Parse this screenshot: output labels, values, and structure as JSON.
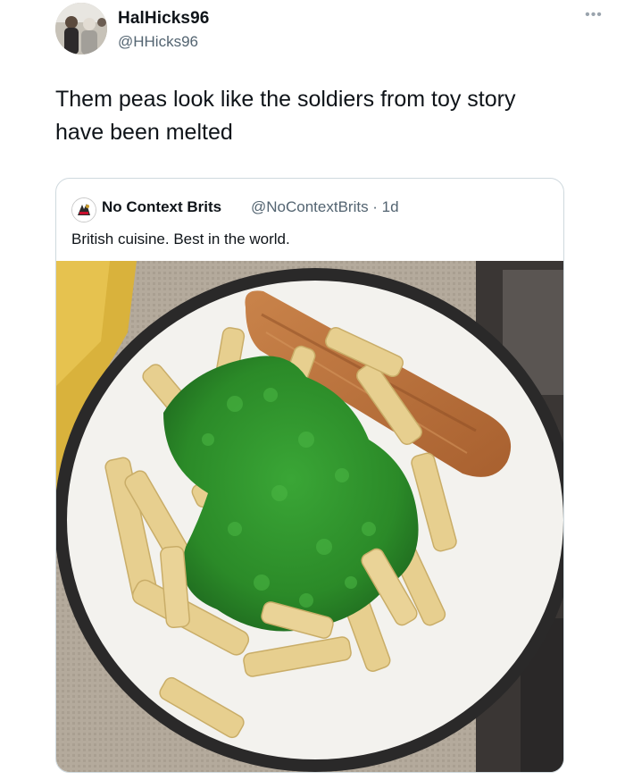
{
  "tweet": {
    "display_name": "HalHicks96",
    "handle": "@HHicks96",
    "more_icon": "ellipsis-icon",
    "text": "Them peas look like the soldiers from toy story have been melted"
  },
  "quote": {
    "author": "No Context Brits",
    "meta": "@NoContextBrits · 1d",
    "text": "British cuisine. Best in the world.",
    "photo": "plate of chips with mushy green peas and a battered sausage"
  },
  "colors": {
    "secondary_text": "#536471",
    "border": "#cfd9de",
    "peas": "#2f8a2a"
  }
}
